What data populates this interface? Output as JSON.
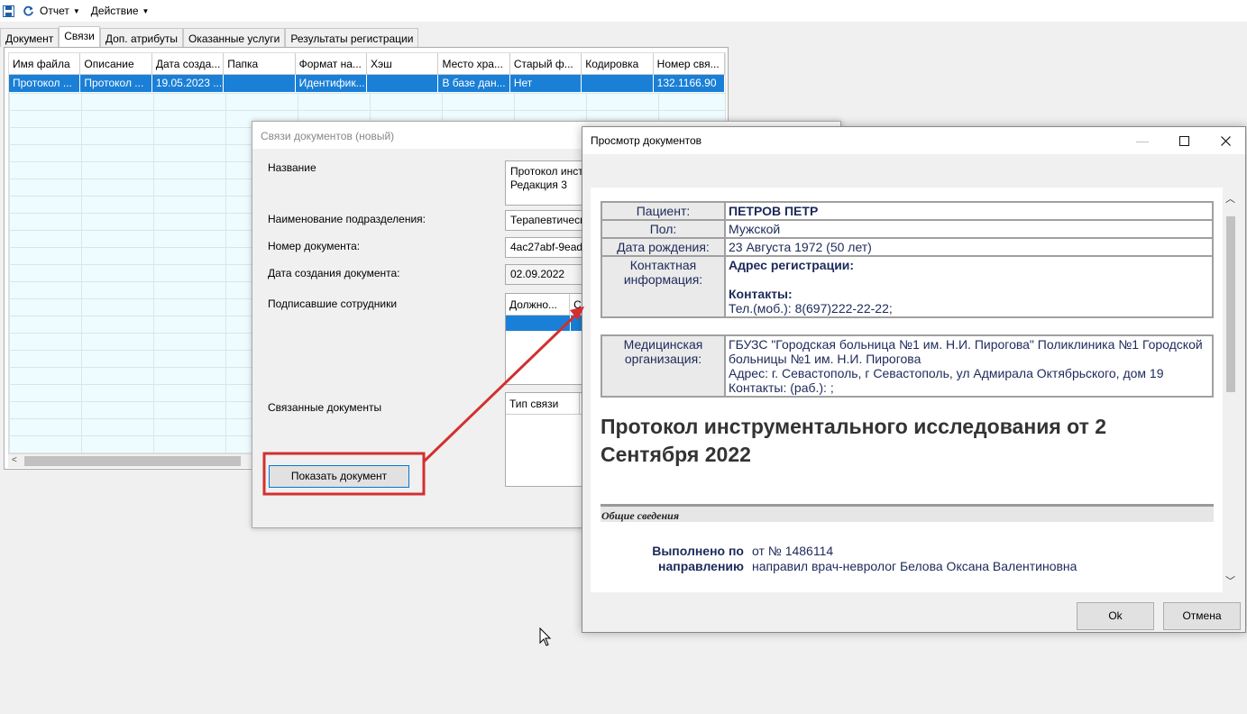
{
  "toolbar": {
    "menus": [
      {
        "label": "Отчет"
      },
      {
        "label": "Действие"
      }
    ]
  },
  "tabs": [
    {
      "label": "Документ"
    },
    {
      "label": "Связи"
    },
    {
      "label": "Доп. атрибуты"
    },
    {
      "label": "Оказанные услуги"
    },
    {
      "label": "Результаты регистрации"
    }
  ],
  "grid": {
    "columns": [
      "Имя файла",
      "Описание",
      "Дата созда...",
      "Папка",
      "Формат на...",
      "Хэш",
      "Место хра...",
      "Старый ф...",
      "Кодировка",
      "Номер свя..."
    ],
    "rows": [
      [
        "Протокол ...",
        "Протокол ...",
        "19.05.2023 ...",
        "",
        "Идентифик...",
        "",
        "В базе дан...",
        "Нет",
        "",
        "132.1166.90"
      ]
    ]
  },
  "links_dialog": {
    "title": "Связи документов (новый)",
    "labels": {
      "name": "Название",
      "dept": "Наименование подразделения:",
      "doc_number": "Номер документа:",
      "created": "Дата создания документа:",
      "signers": "Подписавшие сотрудники",
      "related": "Связанные документы"
    },
    "values": {
      "name_line1": "Протокол инст",
      "name_line2": "Редакция 3",
      "dept": "Терапевтическ",
      "doc_number": "4ac27abf-9ead-",
      "created": "02.09.2022"
    },
    "signers_columns": [
      "Должно...",
      "С"
    ],
    "related_column": "Тип связи",
    "show_button": "Показать документ"
  },
  "viewer_dialog": {
    "title": "Просмотр документов",
    "patient": {
      "patient_label": "Пациент:",
      "patient_value": "ПЕТРОВ ПЕТР",
      "sex_label": "Пол:",
      "sex_value": "Мужской",
      "dob_label": "Дата рождения:",
      "dob_value": "23 Августа 1972 (50 лет)",
      "contact_label": "Контактная информация:",
      "address_heading": "Адрес регистрации:",
      "contacts_heading": "Контакты:",
      "phone": "Тел.(моб.): 8(697)222-22-22;"
    },
    "org": {
      "label": "Медицинская организация:",
      "name": "ГБУЗС \"Городская больница №1 им. Н.И. Пирогова\" Поликлиника №1 Городской больницы №1 им. Н.И. Пирогова",
      "address": "Адрес: г. Севастополь, г Севастополь, ул Адмирала Октябрьского, дом 19",
      "contacts": "Контакты: (раб.): ;"
    },
    "doc_title": "Протокол инструментального исследования от 2 Сентября 2022",
    "section": "Общие сведения",
    "performed_label": "Выполнено по направлению",
    "performed_line1": "от № 1486114",
    "performed_line2": "направил врач-невролог Белова Оксана Валентиновна",
    "ok_button": "Ok",
    "cancel_button": "Отмена"
  },
  "colors": {
    "selection": "#1a7fd6",
    "grid_bg": "#eefcff",
    "highlight": "#d32f2f",
    "doc_text": "#1c2a5a"
  }
}
